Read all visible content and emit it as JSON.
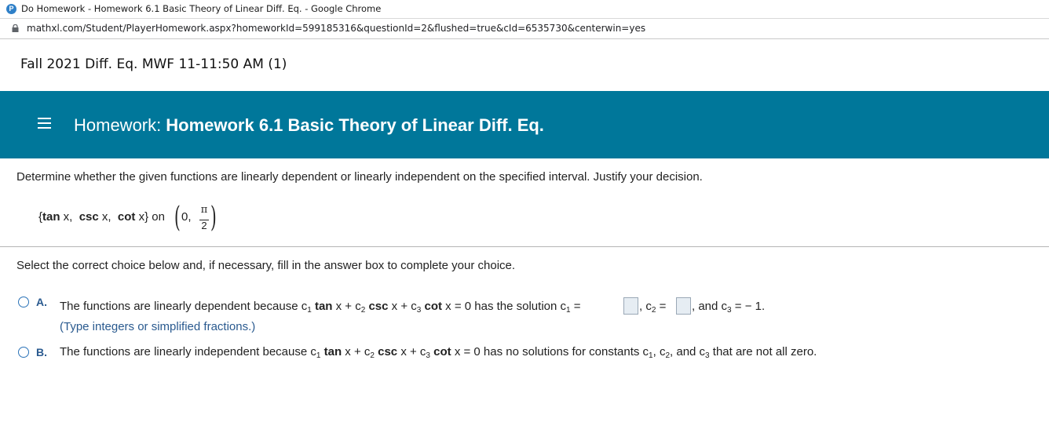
{
  "window": {
    "title": "Do Homework - Homework 6.1 Basic Theory of Linear Diff. Eq. - Google Chrome",
    "url": "mathxl.com/Student/PlayerHomework.aspx?homeworkId=599185316&questionId=2&flushed=true&cId=6535730&centerwin=yes",
    "logo_letter": "P"
  },
  "course": {
    "title": "Fall 2021 Diff. Eq. MWF 11-11:50 AM (1)"
  },
  "homework_bar": {
    "label": "Homework:",
    "name": "Homework 6.1 Basic Theory of Linear Diff. Eq.",
    "bg_color": "#00779a"
  },
  "question": {
    "prompt": "Determine whether the given functions are linearly dependent or linearly independent on the specified interval. Justify your decision.",
    "set_open": "{",
    "f1": "tan",
    "v1": " x,",
    "f2": "csc",
    "v2": " x,",
    "f3": "cot",
    "v3": " x}",
    "on": "on",
    "interval_start": "0,",
    "pi": "π",
    "two": "2"
  },
  "instructions": "Select the correct choice below and, if necessary, fill in the answer box to complete your choice.",
  "choices": [
    {
      "letter": "A.",
      "text_intro": "The functions are linearly dependent because c",
      "eq_tan": "tan",
      "eq_x1": " x + c",
      "eq_csc": "csc",
      "eq_x2": " x + c",
      "eq_cot": "cot",
      "eq_rest": " x = 0 has the solution c",
      "eq_c2": ", c",
      "eq_and": ", and c",
      "eq_c3_val": " = − 1.",
      "equals": " =",
      "hint": "(Type integers or simplified fractions.)",
      "c1_value": "",
      "c2_value": ""
    },
    {
      "letter": "B.",
      "text_intro": "The functions are linearly independent because c",
      "eq_tan": "tan",
      "eq_x1": " x + c",
      "eq_csc": "csc",
      "eq_x2": " x + c",
      "eq_cot": "cot",
      "eq_rest": " x = 0 has no solutions for constants c",
      "sep": ", c",
      "and_c": ", and c",
      "tail": " that are not all zero."
    }
  ],
  "subscripts": {
    "one": "1",
    "two": "2",
    "three": "3"
  }
}
